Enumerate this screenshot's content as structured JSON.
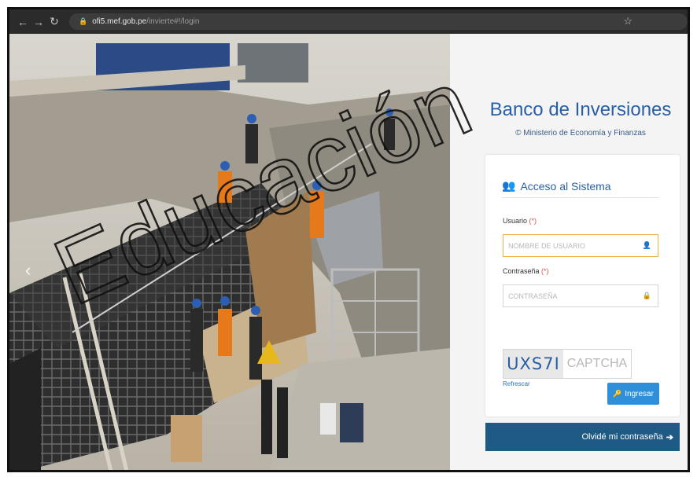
{
  "browser": {
    "url_host": "ofi5.mef.gob.pe",
    "url_path": "/invierte#!/login",
    "back_icon": "arrow-left-icon",
    "forward_icon": "arrow-right-icon",
    "reload_icon": "reload-icon",
    "bookmark_icon": "star-icon"
  },
  "hero": {
    "description_icon": "construction-photo",
    "carousel_prev": "‹"
  },
  "brand": {
    "title": "Banco de Inversiones",
    "subtitle": "© Ministerio de Economía y Finanzas"
  },
  "login": {
    "heading": "Acceso al Sistema",
    "user_label": "Usuario",
    "user_required": "(*)",
    "user_placeholder": "NOMBRE DE USUARIO",
    "password_label": "Contraseña",
    "password_required": "(*)",
    "password_placeholder": "CONTRASEÑA",
    "captcha_code": "UXS7I",
    "captcha_placeholder": "CAPTCHA",
    "refresh_label": "Refrescar",
    "submit_label": "Ingresar",
    "forgot_label": "Olvidé mi contraseña"
  },
  "watermark": {
    "text": "Educación"
  },
  "colors": {
    "accent": "#2b5fa5",
    "button": "#2f8fd8",
    "footer_bar": "#1e5a84"
  }
}
